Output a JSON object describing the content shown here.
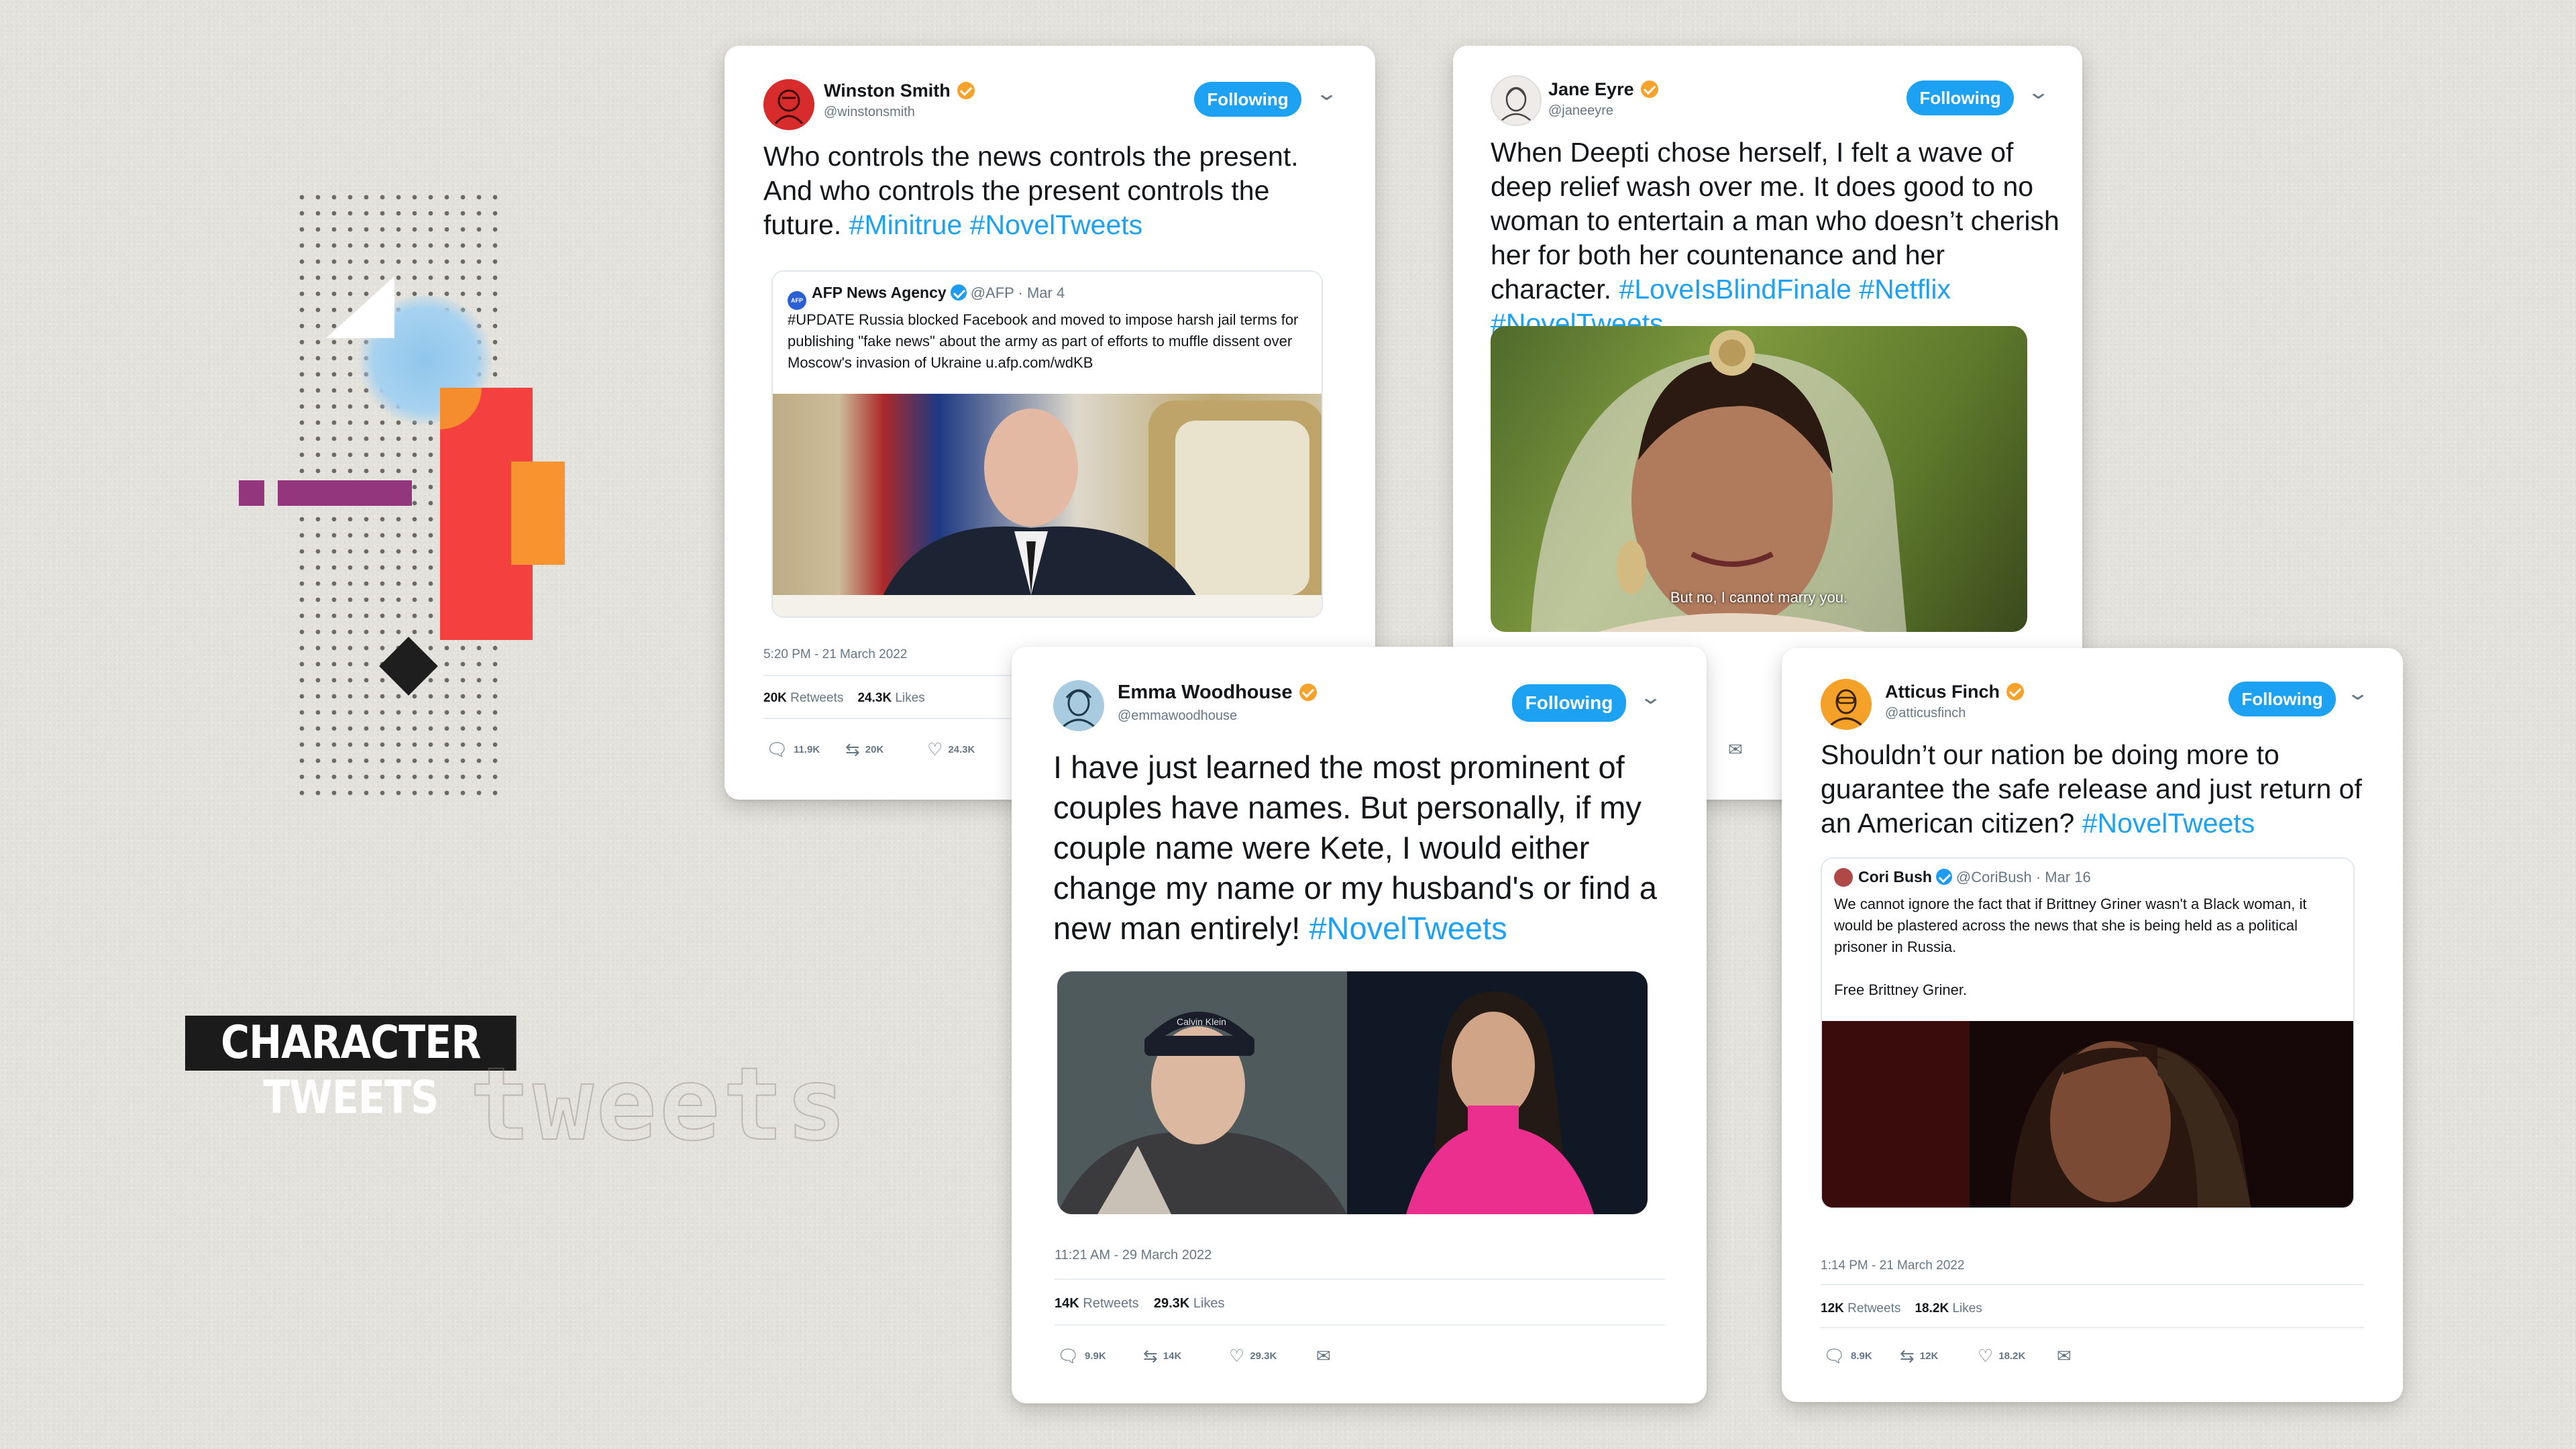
{
  "title": "CHARACTER TWEETS",
  "ghost_word": "tweets",
  "tweets": [
    {
      "name": "Winston Smith",
      "handle": "@winstonsmith",
      "follow_label": "Following",
      "text": "Who controls the news controls the present. And who controls the present controls the future.",
      "hashtags": "#Minitrue #NovelTweets",
      "quote": {
        "avatar_label": "AFP",
        "name": "AFP News Agency",
        "handle": "@AFP · Mar 4",
        "text": "#UPDATE Russia blocked Facebook and moved to impose harsh jail terms for publishing \"fake news\" about the army as part of efforts to muffle dissent over Moscow's invasion of Ukraine u.afp.com/wdKB"
      },
      "timestamp": "5:20 PM - 21 March 2022",
      "retweets": "20K",
      "retweets_label": "Retweets",
      "likes": "24.3K",
      "likes_label": "Likes",
      "replies_count": "11.9K",
      "retweet_count": "20K",
      "like_count": "24.3K"
    },
    {
      "name": "Jane Eyre",
      "handle": "@janeeyre",
      "follow_label": "Following",
      "text": "When Deepti chose herself, I felt a wave of deep relief wash over me. It does good to no woman to entertain a man who doesn’t cherish her for both her countenance and her character.",
      "hashtags": "#LoveIsBlindFinale #Netflix #NovelTweets",
      "media_caption": "But no, I cannot marry you."
    },
    {
      "name": "Emma Woodhouse",
      "handle": "@emmawoodhouse",
      "follow_label": "Following",
      "text": "I have just learned the most prominent of couples have names. But personally, if my couple name were Kete, I would either change my name or my husband's or find a new man entirely!",
      "hashtags": "#NovelTweets",
      "cap_text": "Calvin Klein",
      "timestamp": "11:21 AM - 29 March 2022",
      "retweets": "14K",
      "retweets_label": "Retweets",
      "likes": "29.3K",
      "likes_label": "Likes",
      "replies_count": "9.9K",
      "retweet_count": "14K",
      "like_count": "29.3K"
    },
    {
      "name": "Atticus Finch",
      "handle": "@atticusfinch",
      "follow_label": "Following",
      "text": "Shouldn’t our nation be doing more to guarantee the safe release and just return of an American citizen?",
      "hashtags": "#NovelTweets",
      "quote": {
        "name": "Cori Bush",
        "handle": "@CoriBush · Mar 16",
        "text": "We cannot ignore the fact that if Brittney Griner wasn't a Black woman, it would be plastered across the news that she is being held as a political prisoner in Russia.",
        "text2": "Free Brittney Griner."
      },
      "timestamp": "1:14 PM - 21 March 2022",
      "retweets": "12K",
      "retweets_label": "Retweets",
      "likes": "18.2K",
      "likes_label": "Likes",
      "replies_count": "8.9K",
      "retweet_count": "12K",
      "like_count": "18.2K"
    }
  ],
  "icons": {
    "reply": "speech-bubble",
    "retweet": "loop-arrows",
    "like": "heart",
    "message": "envelope",
    "dropdown": "chevron-down"
  },
  "colors": {
    "accent": "#1da1f2",
    "verified": "#f7a22b",
    "red": "#f4413f",
    "orange": "#f7942f",
    "purple": "#93367e",
    "blue_blob": "#8fc6ec"
  }
}
